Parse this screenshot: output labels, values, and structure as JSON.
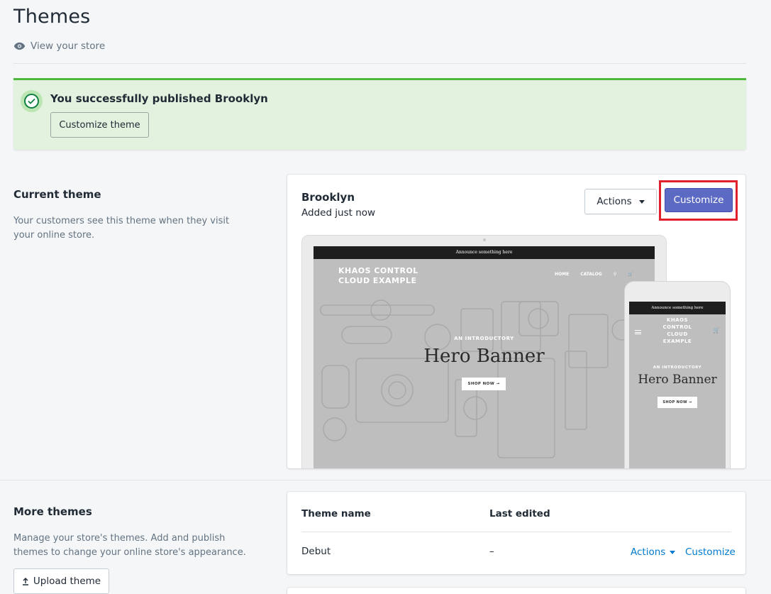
{
  "header": {
    "title": "Themes",
    "view_store_label": "View your store"
  },
  "banner": {
    "message": "You successfully published Brooklyn",
    "button_label": "Customize theme",
    "accent_color": "#50b83c"
  },
  "current_theme": {
    "section_title": "Current theme",
    "section_description": "Your customers see this theme when they visit your online store.",
    "theme_name": "Brooklyn",
    "added_text": "Added just now",
    "actions_label": "Actions",
    "customize_label": "Customize",
    "customize_color": "#5c6ac4",
    "preview": {
      "announcement": "Announce something here",
      "shop_name_line1": "KHAOS CONTROL",
      "shop_name_line2": "CLOUD EXAMPLE",
      "nav_home": "HOME",
      "nav_catalog": "CATALOG",
      "intro": "AN INTRODUCTORY",
      "hero": "Hero Banner",
      "shop_button": "SHOP NOW →",
      "phone_shop_line1": "KHAOS",
      "phone_shop_line2": "CONTROL",
      "phone_shop_line3": "CLOUD",
      "phone_shop_line4": "EXAMPLE"
    }
  },
  "more_themes": {
    "section_title": "More themes",
    "section_description": "Manage your store's themes. Add and publish themes to change your online store's appearance.",
    "upload_label": "Upload theme",
    "columns": [
      "Theme name",
      "Last edited"
    ],
    "rows": [
      {
        "name": "Debut",
        "last_edited": "–",
        "actions_label": "Actions",
        "customize_label": "Customize"
      }
    ],
    "link_color": "#007ace"
  }
}
